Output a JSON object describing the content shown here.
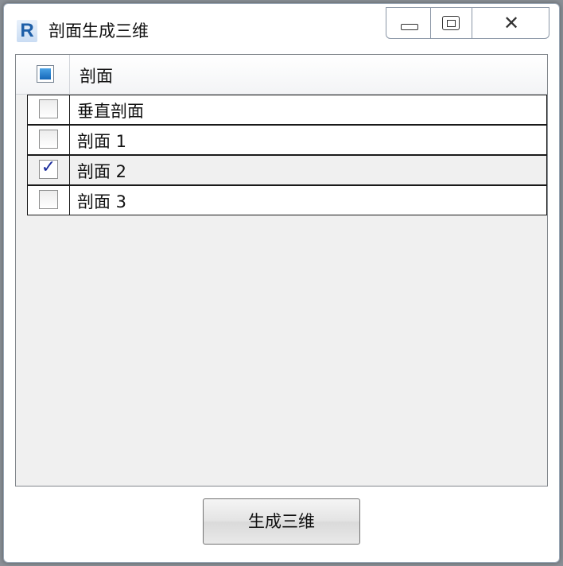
{
  "window": {
    "title": "剖面生成三维"
  },
  "titlebar": {
    "app_icon_letter": "R",
    "buttons": [
      {
        "icon": "minimize-icon"
      },
      {
        "icon": "maximize-icon"
      },
      {
        "icon": "close-icon",
        "glyph": "✕"
      }
    ]
  },
  "list": {
    "header": {
      "label": "剖面",
      "select_all_state": "indeterminate"
    },
    "rows": [
      {
        "label": "垂直剖面",
        "checked": false
      },
      {
        "label": "剖面 1",
        "checked": false
      },
      {
        "label": "剖面 2",
        "checked": true
      },
      {
        "label": "剖面 3",
        "checked": false
      }
    ]
  },
  "footer": {
    "generate_label": "生成三维"
  },
  "colors": {
    "check_blue": "#1467b8",
    "check_mark": "#1b2c9c",
    "app_icon": "#1e5fa8"
  }
}
